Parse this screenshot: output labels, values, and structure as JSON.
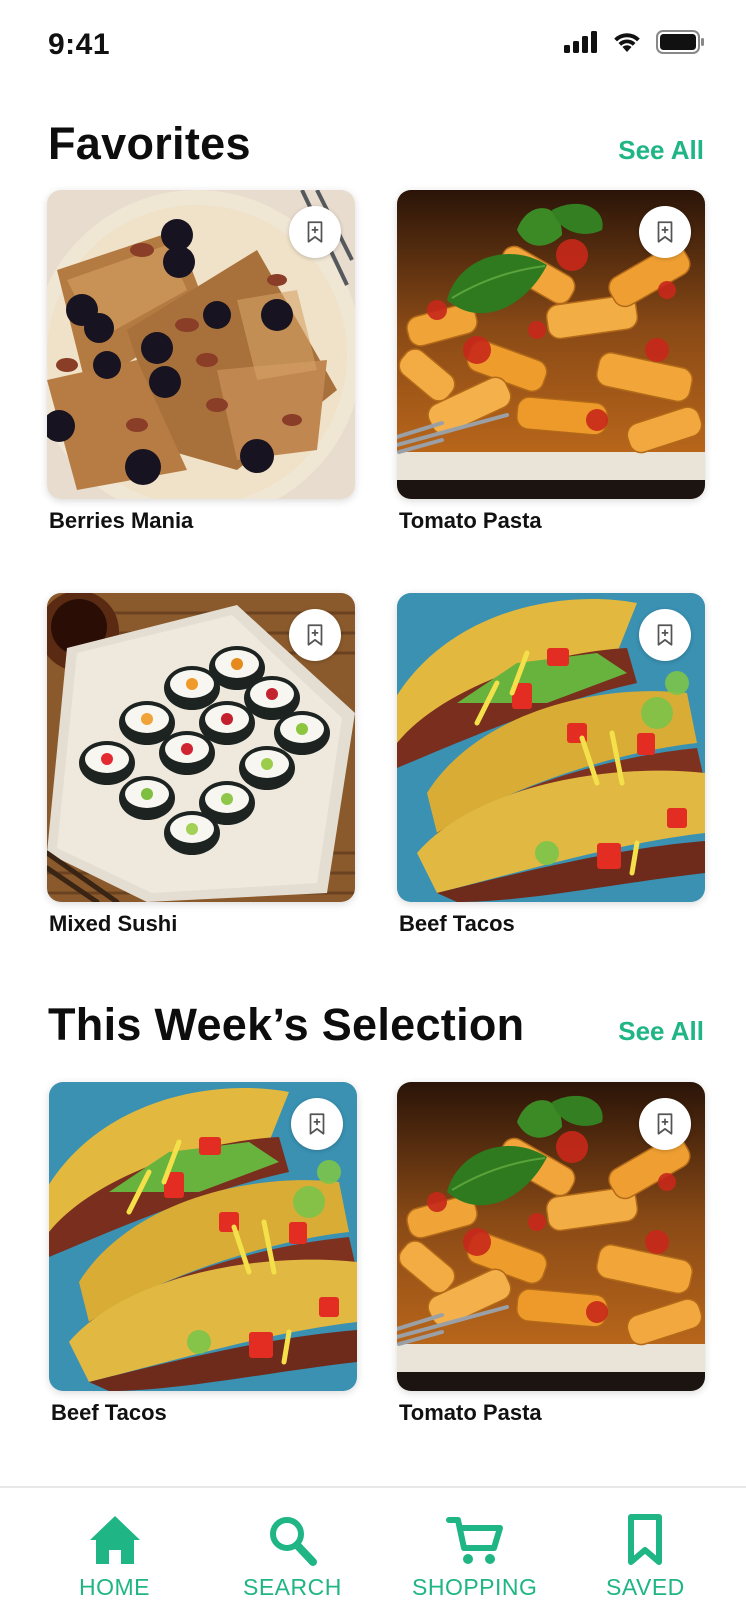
{
  "status_bar": {
    "time": "9:41"
  },
  "sections": {
    "favorites": {
      "title": "Favorites",
      "see_all": "See All",
      "items": [
        {
          "name": "Berries Mania",
          "image": "french-toast-berries"
        },
        {
          "name": "Tomato Pasta",
          "image": "tomato-pasta"
        },
        {
          "name": "Mixed Sushi",
          "image": "sushi-rolls"
        },
        {
          "name": "Beef Tacos",
          "image": "beef-tacos"
        }
      ]
    },
    "weekly": {
      "title": "This Week’s Selection",
      "see_all": "See All",
      "items": [
        {
          "name": "Beef Tacos",
          "image": "beef-tacos"
        },
        {
          "name": "Tomato Pasta",
          "image": "tomato-pasta"
        }
      ]
    }
  },
  "bottom_nav": {
    "items": [
      {
        "label": "HOME",
        "icon": "home-icon"
      },
      {
        "label": "SEARCH",
        "icon": "search-icon"
      },
      {
        "label": "SHOPPING",
        "icon": "cart-icon"
      },
      {
        "label": "SAVED",
        "icon": "bookmark-icon"
      }
    ]
  },
  "colors": {
    "accent": "#1fb584",
    "text": "#111111",
    "background": "#ffffff"
  },
  "icons": {
    "bookmark_add": "bookmark-add-icon"
  }
}
